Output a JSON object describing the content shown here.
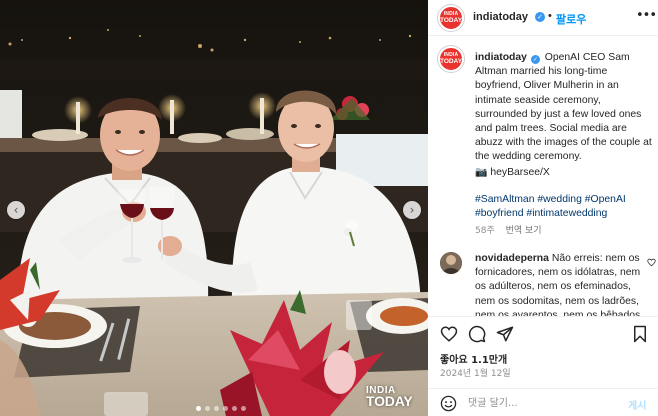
{
  "header": {
    "avatar_line1": "INDIA",
    "avatar_line2": "TODAY",
    "username": "indiatoday",
    "separator": "•",
    "follow_label": "팔로우",
    "more_icon": "more-horizontal-icon"
  },
  "caption": {
    "username": "indiatoday",
    "text": "OpenAI CEO Sam Altman married his long-time boyfriend, Oliver Mulherin in an intimate seaside ceremony, surrounded by just a few loved ones and palm trees. Social media are abuzz with the images of the couple at the wedding ceremony.",
    "credit": "heyBarsee/X",
    "hashtags": "#SamAltman #wedding #OpenAI #boyfriend #intimatewedding",
    "age": "58주",
    "translate_label": "번역 보기"
  },
  "comment": {
    "username": "novidadeperna",
    "text": "Não erreis: nem os fornicadores, nem os idólatras, nem os adúlteros, nem os efeminados, nem os sodomitas, nem os ladrões, nem os avarentos, nem os bêbados"
  },
  "actions": {
    "icons": [
      "heart-icon",
      "comment-icon",
      "share-icon",
      "bookmark-icon"
    ],
    "likes": "좋아요 1.1만개",
    "date": "2024년 1월 12일"
  },
  "add_comment": {
    "placeholder": "댓글 달기...",
    "post_label": "게시"
  },
  "photo": {
    "watermark_line1": "INDIA",
    "watermark_line2": "TODAY",
    "carousel_dots": 6,
    "active_dot": 0
  },
  "colors": {
    "link": "#00376b",
    "follow": "#0095f6",
    "verified": "#3897f0",
    "brand": "#e8332f"
  }
}
